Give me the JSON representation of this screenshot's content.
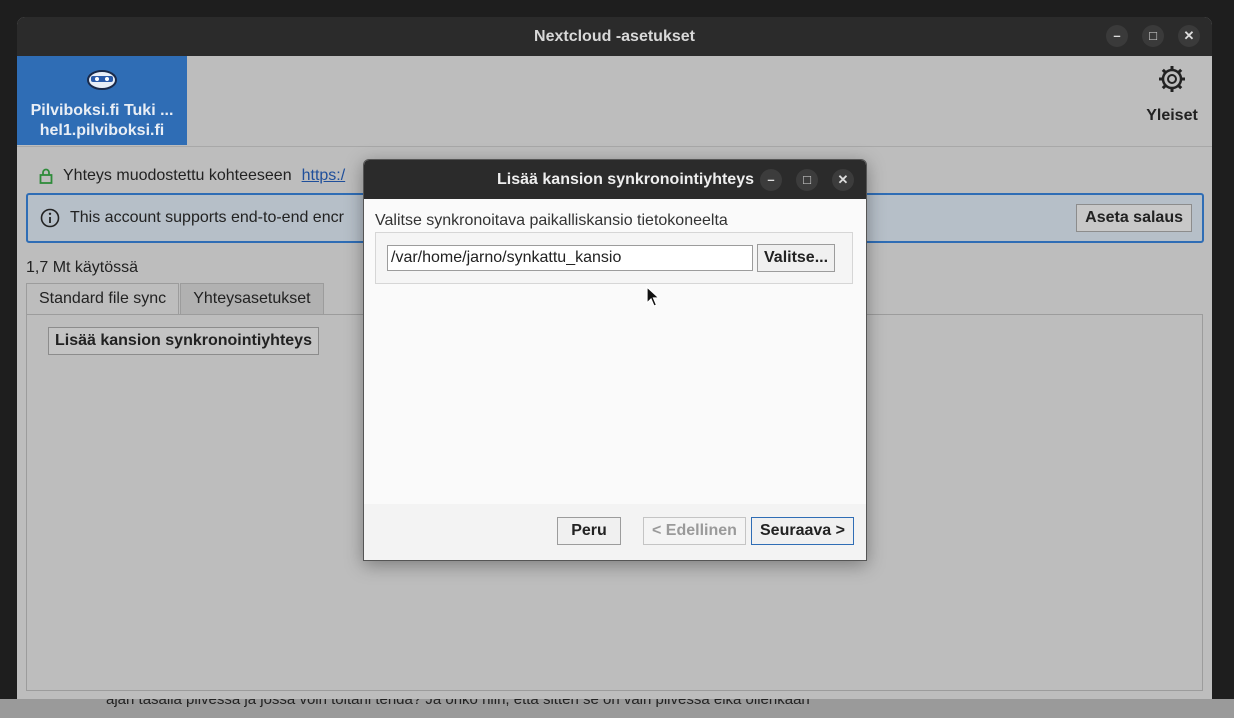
{
  "window": {
    "title": "Nextcloud -asetukset"
  },
  "account": {
    "name": "Pilviboksi.fi Tuki ...",
    "server": "hel1.pilviboksi.fi"
  },
  "general": {
    "label": "Yleiset"
  },
  "status": {
    "text": "Yhteys muodostettu kohteeseen",
    "link": "https:/"
  },
  "banner": {
    "text": "This account supports end-to-end encr",
    "button": "Aseta salaus"
  },
  "usage": "1,7 Mt käytössä",
  "tabs": [
    {
      "label": "Standard file sync"
    },
    {
      "label": "Yhteysasetukset"
    }
  ],
  "panel": {
    "add_button": "Lisää kansion synkronointiyhteys"
  },
  "dialog": {
    "title": "Lisää kansion synkronointiyhteys",
    "label": "Valitse synkronoitava paikalliskansio tietokoneelta",
    "path_value": "/var/home/jarno/synkattu_kansio",
    "browse": "Valitse...",
    "cancel": "Peru",
    "back": "< Edellinen",
    "next": "Seuraava >"
  },
  "background_text": "ajan tasalla pilvessä ja jossa voin toitani tehdä? Ja onko niin, että sitten se on vain pilvessä eikä ollenkaan"
}
